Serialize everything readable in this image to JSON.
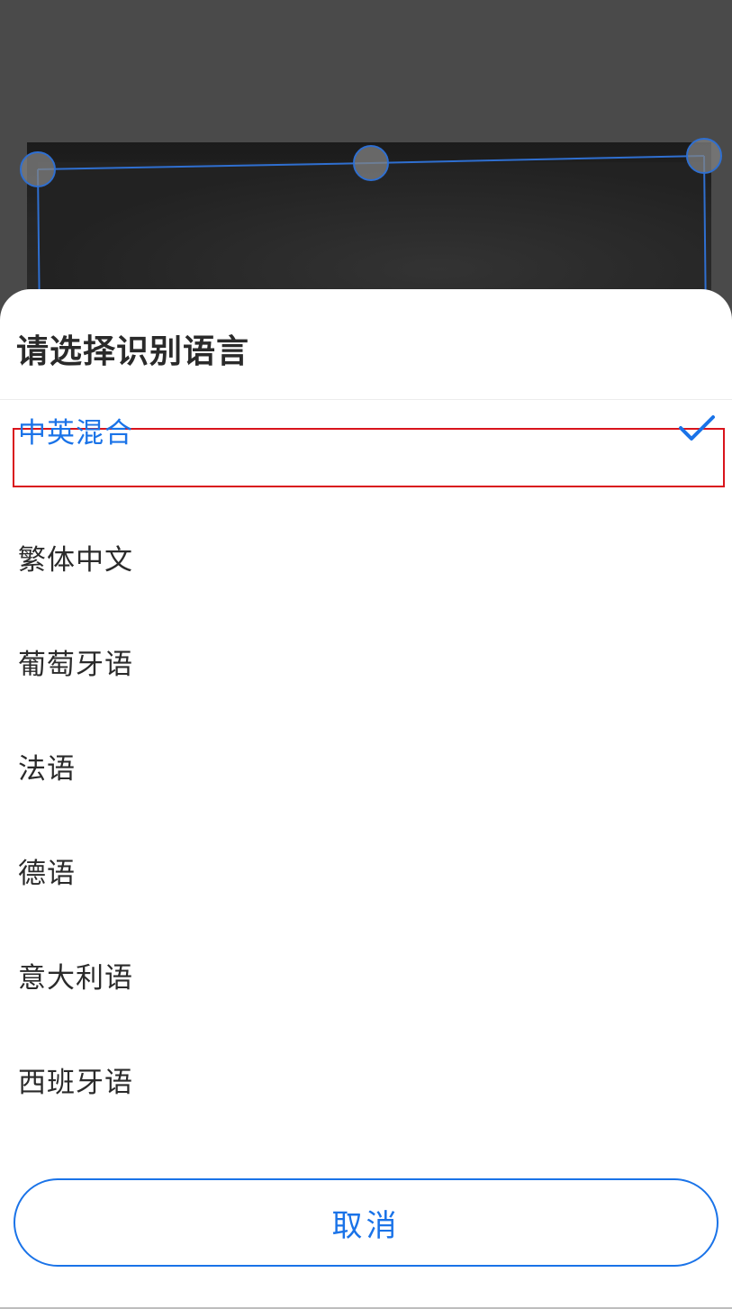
{
  "sheet": {
    "title": "请选择识别语言",
    "languages": [
      {
        "label": "中英混合",
        "selected": true
      },
      {
        "label": "繁体中文",
        "selected": false
      },
      {
        "label": "葡萄牙语",
        "selected": false
      },
      {
        "label": "法语",
        "selected": false
      },
      {
        "label": "德语",
        "selected": false
      },
      {
        "label": "意大利语",
        "selected": false
      },
      {
        "label": "西班牙语",
        "selected": false
      }
    ],
    "cancel_label": "取消"
  },
  "icons": {
    "selected_check": "checkmark-icon",
    "crop_handles": "crop-handle-icon"
  },
  "colors": {
    "accent": "#1a73e8",
    "highlight_frame": "#d9141c",
    "crop_line": "#2f6fd0"
  }
}
